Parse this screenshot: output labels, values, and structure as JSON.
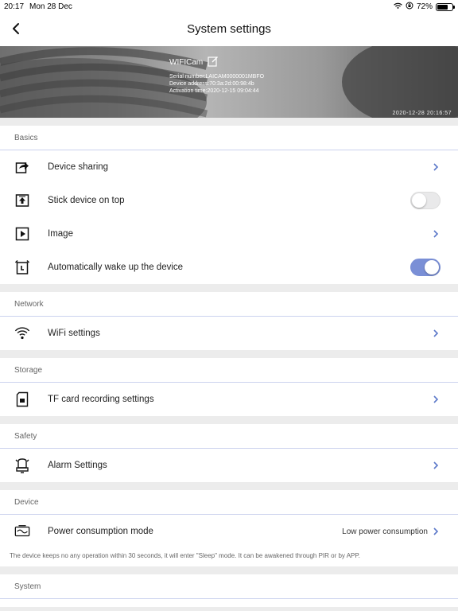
{
  "status_bar": {
    "time": "20:17",
    "date": "Mon 28 Dec",
    "battery": "72%",
    "battery_level": 0.72
  },
  "nav": {
    "title": "System settings"
  },
  "device": {
    "name": "WIFICam",
    "serial": "Serial number:LAICAM0000001MBFO",
    "address": "Device address:70:3a:2d:00:98:4b",
    "activation": "Activation time:2020-12-15 09:04:44",
    "timestamp": "2020-12-28 20:16:57"
  },
  "sections": {
    "basics": {
      "header": "Basics",
      "device_sharing": "Device sharing",
      "stick_on_top": "Stick device on top",
      "stick_on_top_enabled": false,
      "image": "Image",
      "auto_wake": "Automatically wake up the device",
      "auto_wake_enabled": true
    },
    "network": {
      "header": "Network",
      "wifi": "WiFi settings"
    },
    "storage": {
      "header": "Storage",
      "tf_card": "TF card recording settings"
    },
    "safety": {
      "header": "Safety",
      "alarm": "Alarm Settings"
    },
    "device": {
      "header": "Device",
      "power_mode": "Power consumption mode",
      "power_mode_value": "Low power consumption",
      "power_note": "The device keeps no any operation within 30 seconds, it will enter \"Sleep\" mode. It can be awakened through PIR or by APP."
    },
    "system": {
      "header": "System"
    }
  },
  "colors": {
    "accent": "#7a8fd6",
    "chevron": "#5b78c9"
  }
}
